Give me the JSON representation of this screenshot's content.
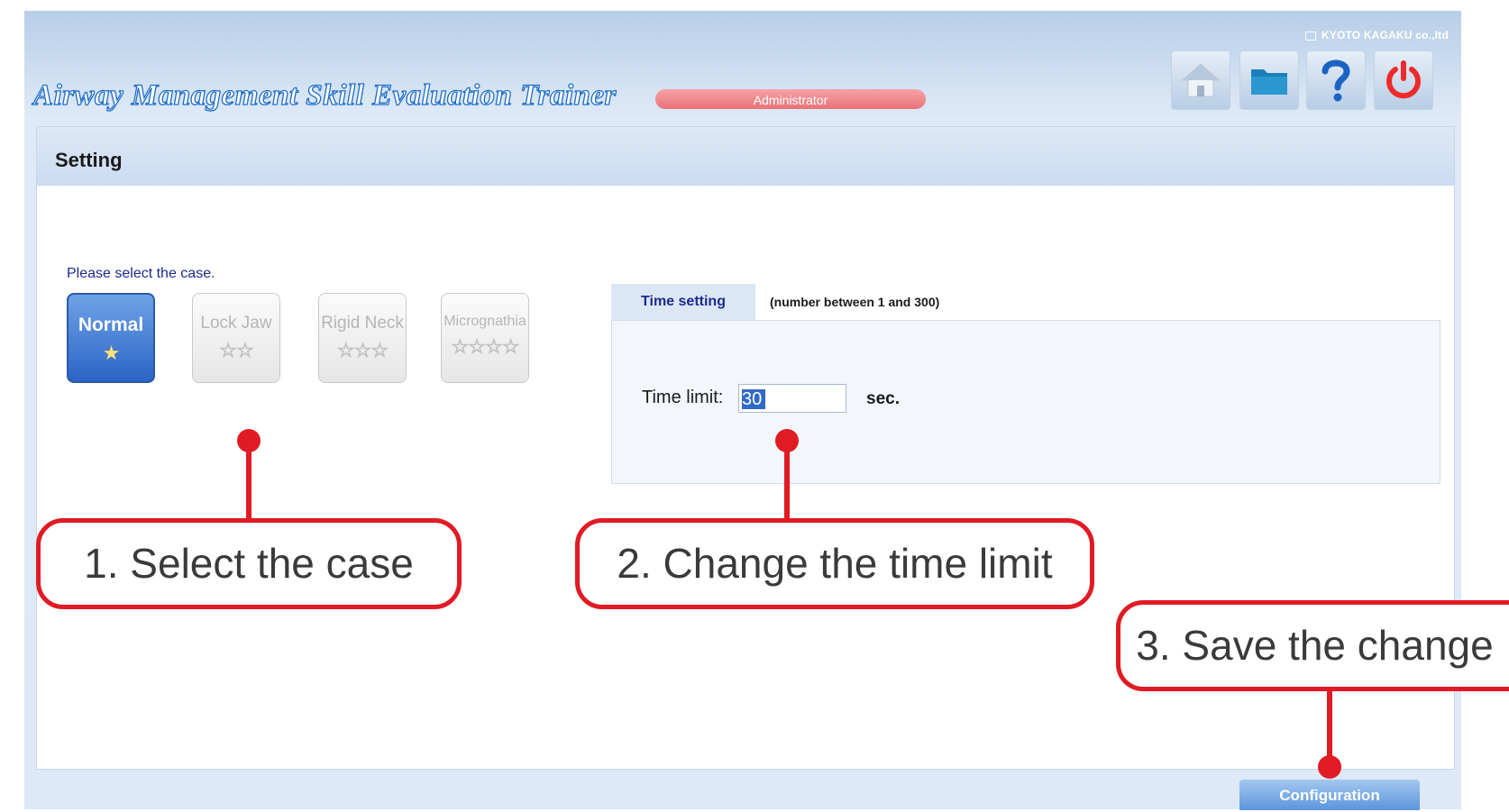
{
  "header": {
    "brand": "KYOTO KAGAKU co.,ltd",
    "app_title": "Airway Management Skill Evaluation Trainer",
    "role": "Administrator",
    "toolbar": [
      "home-icon",
      "folder-icon",
      "help-icon",
      "power-icon"
    ]
  },
  "panel": {
    "title": "Setting",
    "select_label": "Please select the case.",
    "cases": [
      {
        "name": "Normal",
        "stars": "★",
        "selected": true
      },
      {
        "name": "Lock Jaw",
        "stars": "☆☆",
        "selected": false
      },
      {
        "name": "Rigid Neck",
        "stars": "☆☆☆",
        "selected": false
      },
      {
        "name": "Micrognathia",
        "stars": "☆☆☆☆",
        "selected": false
      }
    ],
    "time_setting": {
      "tab_label": "Time setting",
      "hint": "(number between 1 and 300)",
      "limit_label": "Time limit:",
      "limit_value": "30",
      "unit": "sec."
    },
    "config_button": "Configuration"
  },
  "annotations": {
    "step1": "1. Select the case",
    "step2": "2. Change the time limit",
    "step3": "3. Save the change"
  },
  "colors": {
    "accent_blue": "#2b64c6",
    "annotation_red": "#e01b24",
    "role_pill": "#e97278"
  }
}
